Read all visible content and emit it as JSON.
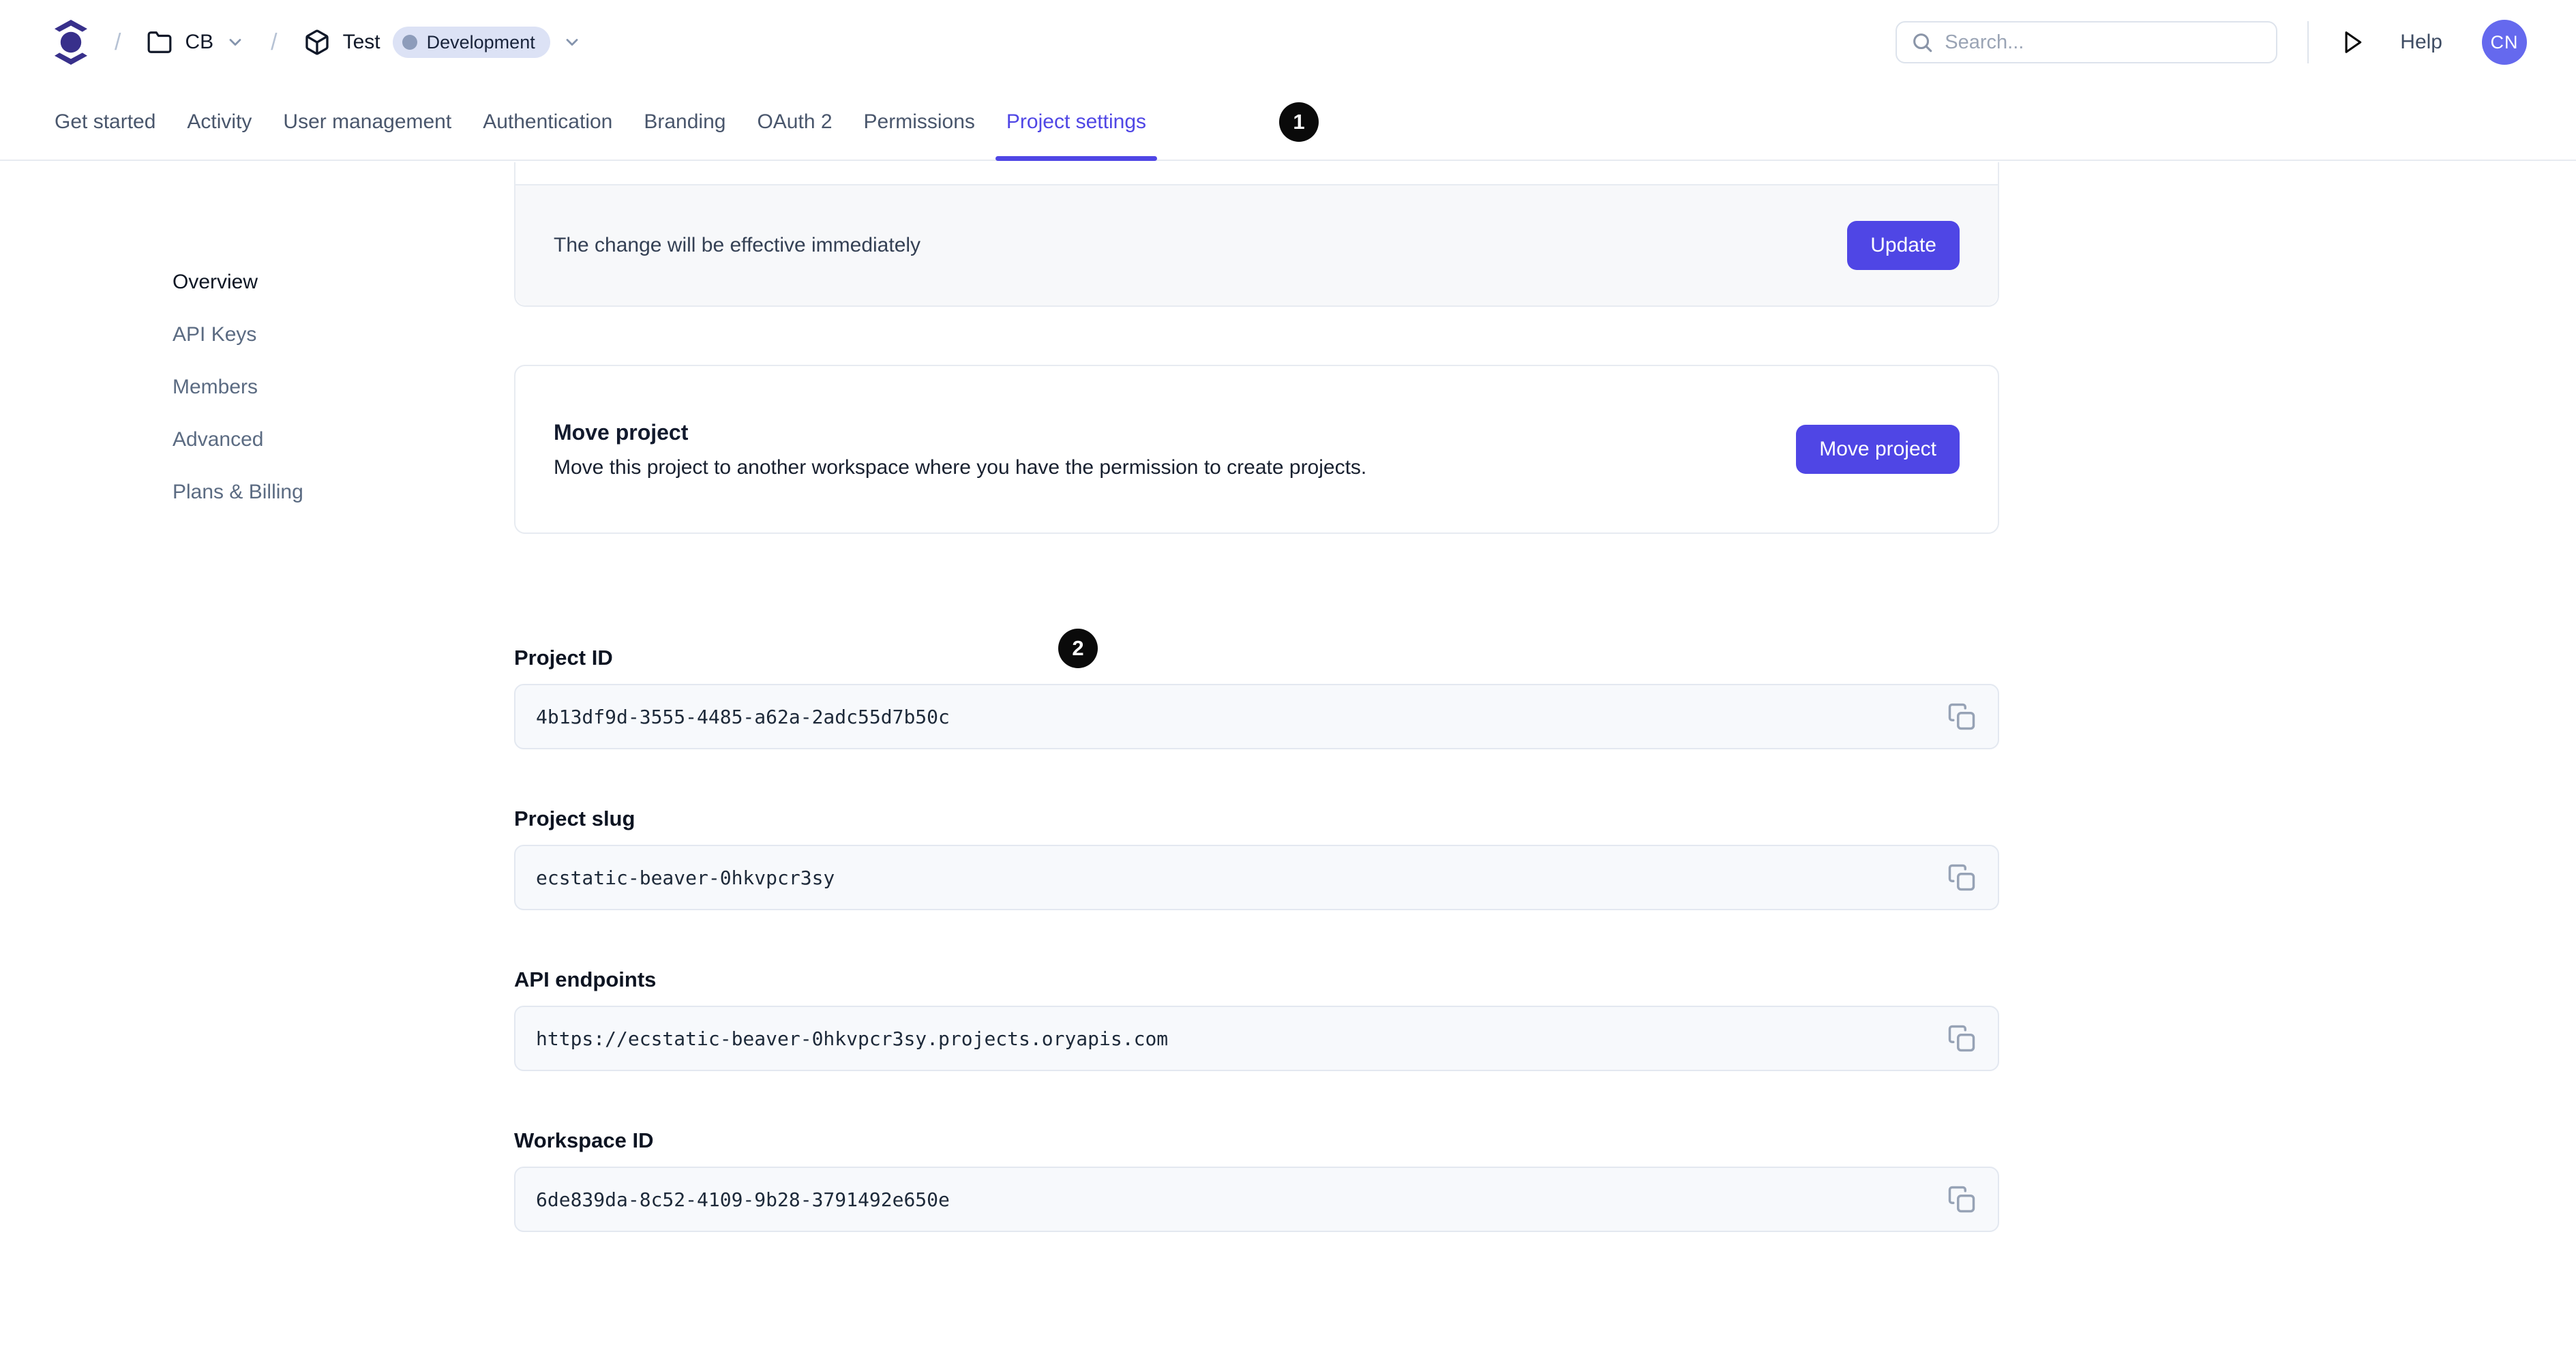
{
  "header": {
    "breadcrumb": {
      "separator": "/",
      "workspace_label": "CB",
      "project_label": "Test",
      "environment_badge": "Development"
    },
    "search": {
      "placeholder": "Search..."
    },
    "help_label": "Help",
    "avatar_initials": "CN"
  },
  "tabs": {
    "items": [
      {
        "label": "Get started",
        "active": false
      },
      {
        "label": "Activity",
        "active": false
      },
      {
        "label": "User management",
        "active": false
      },
      {
        "label": "Authentication",
        "active": false
      },
      {
        "label": "Branding",
        "active": false
      },
      {
        "label": "OAuth 2",
        "active": false
      },
      {
        "label": "Permissions",
        "active": false
      },
      {
        "label": "Project settings",
        "active": true
      }
    ]
  },
  "annotations": {
    "marker1": "1",
    "marker2": "2"
  },
  "sidebar": {
    "items": [
      {
        "label": "Overview",
        "active": true
      },
      {
        "label": "API Keys",
        "active": false
      },
      {
        "label": "Members",
        "active": false
      },
      {
        "label": "Advanced",
        "active": false
      },
      {
        "label": "Plans & Billing",
        "active": false
      }
    ]
  },
  "main": {
    "update_card": {
      "message": "The change will be effective immediately",
      "button_label": "Update"
    },
    "move_card": {
      "title": "Move project",
      "description": "Move this project to another workspace where you have the permission to create projects.",
      "button_label": "Move project"
    },
    "fields": [
      {
        "label": "Project ID",
        "value": "4b13df9d-3555-4485-a62a-2adc55d7b50c"
      },
      {
        "label": "Project slug",
        "value": "ecstatic-beaver-0hkvpcr3sy"
      },
      {
        "label": "API endpoints",
        "value": "https://ecstatic-beaver-0hkvpcr3sy.projects.oryapis.com"
      },
      {
        "label": "Workspace ID",
        "value": "6de839da-8c52-4109-9b28-3791492e650e"
      }
    ]
  },
  "colors": {
    "accent": "#4f46e5",
    "logo": "#38308b",
    "avatar_bg": "#6569ee",
    "environment_badge_bg": "#dce2f5",
    "marker_bg": "#0a0a0a"
  }
}
